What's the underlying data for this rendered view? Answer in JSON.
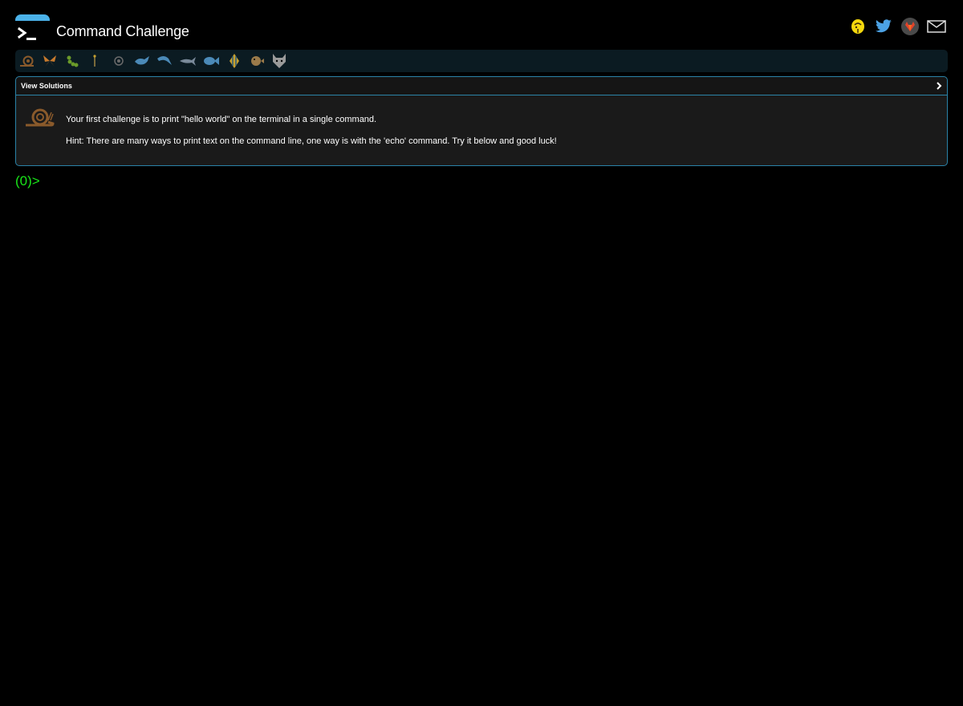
{
  "header": {
    "title": "Command Challenge",
    "logo_icon": "terminal-prompt-icon",
    "social": [
      {
        "name": "buymeacoffee-icon",
        "color": "#f4d80d"
      },
      {
        "name": "twitter-icon",
        "color": "#4ca2e4"
      },
      {
        "name": "gitlab-icon",
        "color": "#e2432a"
      },
      {
        "name": "mail-icon",
        "color": "#dddddd"
      }
    ]
  },
  "levels": [
    {
      "name": "snail-icon",
      "color": "#8a5a2b"
    },
    {
      "name": "moth-icon",
      "color": "#c77a2e"
    },
    {
      "name": "caterpillar-icon",
      "color": "#6a9a2a"
    },
    {
      "name": "worm-icon",
      "color": "#7a6a3a"
    },
    {
      "name": "circle-icon",
      "color": "#6a6a6a"
    },
    {
      "name": "whale-icon",
      "color": "#4b8ab8"
    },
    {
      "name": "dolphin-icon",
      "color": "#4b8ab8"
    },
    {
      "name": "shark-icon",
      "color": "#7a8a9a"
    },
    {
      "name": "fish-icon",
      "color": "#4b8ab8"
    },
    {
      "name": "angelfish-icon",
      "color": "#c7a02e"
    },
    {
      "name": "pufferfish-icon",
      "color": "#9a7a4a"
    },
    {
      "name": "wolf-icon",
      "color": "#9a9a9a"
    }
  ],
  "panel": {
    "header_label": "View Solutions",
    "challenge": "Your first challenge is to print \"hello world\" on the terminal in a single command.",
    "hint": "Hint: There are many ways to print text on the command line, one way is with the 'echo' command. Try it below and good luck!"
  },
  "prompt": {
    "label": "(0)>",
    "value": ""
  },
  "colors": {
    "accent": "#2b83a8",
    "prompt": "#19e619",
    "logo_bar": "#4bb2e9"
  }
}
